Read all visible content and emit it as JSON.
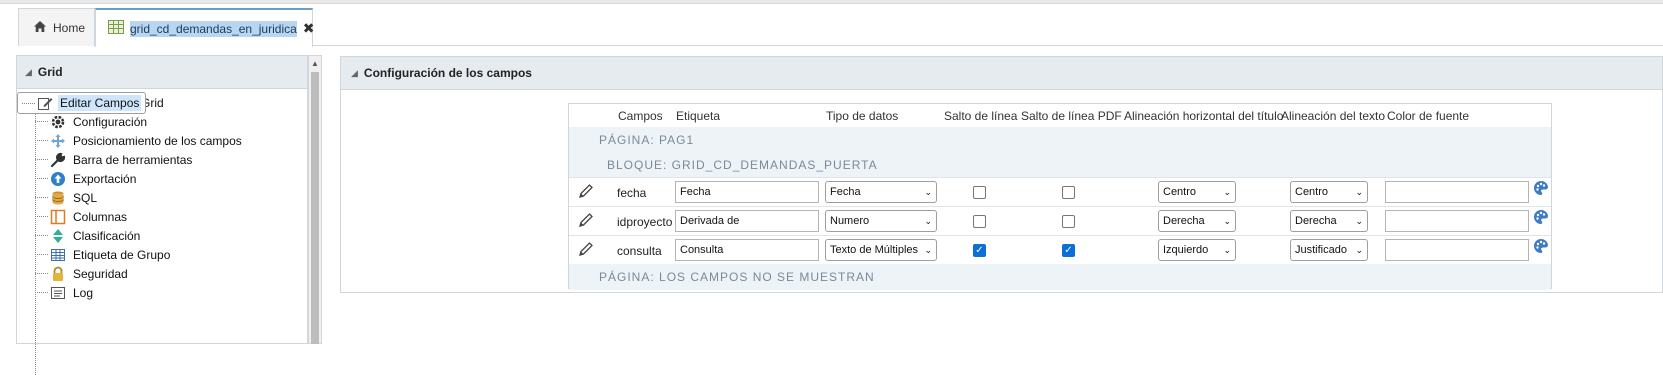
{
  "tabs": {
    "home_label": "Home",
    "active_label": "grid_cd_demandas_en_juridica",
    "close_glyph": "✖"
  },
  "left_panel": {
    "title": "Grid",
    "items": [
      {
        "label": "Módulos del Grid",
        "icon": "modules-icon"
      },
      {
        "label": "Configuración",
        "icon": "gear-icon"
      },
      {
        "label": "Editar Campos",
        "icon": "edit-icon",
        "selected": true
      },
      {
        "label": "Posicionamiento de los campos",
        "icon": "move-icon"
      },
      {
        "label": "Barra de herramientas",
        "icon": "wrench-icon"
      },
      {
        "label": "Exportación",
        "icon": "export-icon"
      },
      {
        "label": "SQL",
        "icon": "database-icon"
      },
      {
        "label": "Columnas",
        "icon": "columns-icon"
      },
      {
        "label": "Clasificación",
        "icon": "sort-icon"
      },
      {
        "label": "Etiqueta de Grupo",
        "icon": "table-icon"
      },
      {
        "label": "Seguridad",
        "icon": "lock-icon"
      },
      {
        "label": "Log",
        "icon": "log-icon"
      }
    ]
  },
  "right_panel": {
    "title": "Configuración de los campos"
  },
  "grid": {
    "headers": {
      "campos": "Campos",
      "etiqueta": "Etiqueta",
      "tipo": "Tipo de datos",
      "salto": "Salto de línea",
      "salto_pdf": "Salto de línea PDF",
      "alin_titulo": "Alineación horizontal del título",
      "alin_texto": "Alineación del texto",
      "color": "Color de fuente"
    },
    "page_label": "PÁGINA: PAG1",
    "block_label": "BLOQUE: GRID_CD_DEMANDAS_PUERTA",
    "rows": [
      {
        "campo": "fecha",
        "etiqueta": "Fecha",
        "tipo": "Fecha",
        "salto": false,
        "salto_pdf": false,
        "alin_titulo": "Centro",
        "alin_texto": "Centro",
        "color": ""
      },
      {
        "campo": "idproyecto",
        "etiqueta": "Derivada de",
        "tipo": "Numero",
        "salto": false,
        "salto_pdf": false,
        "alin_titulo": "Derecha",
        "alin_texto": "Derecha",
        "color": ""
      },
      {
        "campo": "consulta",
        "etiqueta": "Consulta",
        "tipo": "Texto de Múltiples",
        "salto": true,
        "salto_pdf": true,
        "alin_titulo": "Izquierdo",
        "alin_texto": "Justificado",
        "color": ""
      }
    ],
    "hidden_label": "PÁGINA: LOS CAMPOS NO SE MUESTRAN"
  },
  "colors": {
    "accent": "#6a9ec6",
    "selection": "#cfe5fb",
    "checkbox_on": "#0b6fd6"
  }
}
